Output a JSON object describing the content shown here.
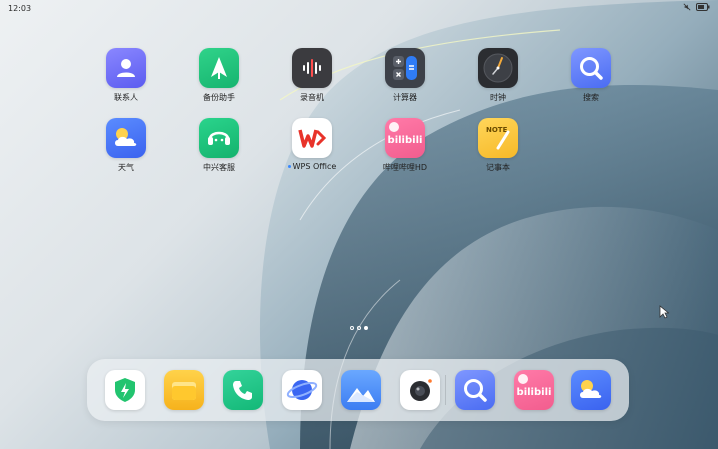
{
  "status": {
    "time": "12:03"
  },
  "apps": [
    {
      "label": "联系人",
      "icon": "contacts-icon"
    },
    {
      "label": "备份助手",
      "icon": "backup-assistant-icon"
    },
    {
      "label": "录音机",
      "icon": "voice-recorder-icon"
    },
    {
      "label": "计算器",
      "icon": "calculator-icon"
    },
    {
      "label": "时钟",
      "icon": "clock-icon"
    },
    {
      "label": "搜索",
      "icon": "search-icon"
    },
    {
      "label": "天气",
      "icon": "weather-icon"
    },
    {
      "label": "中兴客服",
      "icon": "customer-service-icon"
    },
    {
      "label": "WPS Office",
      "icon": "wps-office-icon",
      "new_dot": true
    },
    {
      "label": "哔哩哔哩HD",
      "icon": "bilibili-hd-icon"
    },
    {
      "label": "记事本",
      "icon": "notepad-icon",
      "badge": "NOTE"
    }
  ],
  "dock": [
    {
      "icon": "security-shield-icon"
    },
    {
      "icon": "file-manager-icon"
    },
    {
      "icon": "phone-icon"
    },
    {
      "icon": "browser-icon"
    },
    {
      "icon": "gallery-icon"
    },
    {
      "icon": "camera-icon"
    },
    {
      "icon": "search-icon"
    },
    {
      "icon": "bilibili-icon"
    },
    {
      "icon": "weather-icon"
    }
  ],
  "pager": {
    "pages": 3,
    "active": 3
  },
  "bilibili_text": "bilibili",
  "colors": {
    "accent": "#3a88ff",
    "wps_red": "#e8332a",
    "bilibili_pink": "#f25d8e"
  }
}
